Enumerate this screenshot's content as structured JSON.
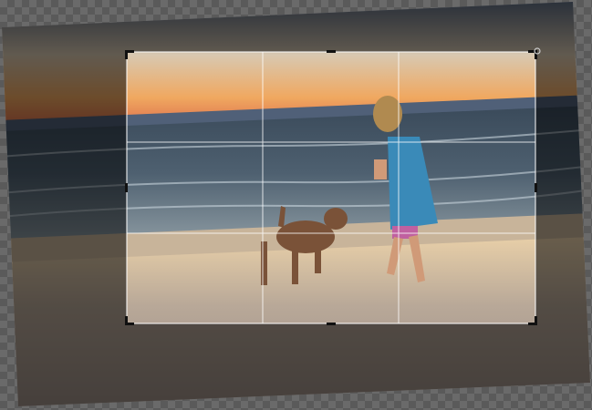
{
  "editor": {
    "mode": "crop",
    "overlay": "rule-of-thirds",
    "grid_divisions": 3,
    "rotation_degrees": -2.5,
    "colors": {
      "canvas_checker_light": "#6a6a6a",
      "canvas_checker_dark": "#5a5a5a",
      "crop_border": "#ffffff",
      "outside_dim": "#000000"
    },
    "icons": [
      "rotate-handle-icon",
      "corner-handle-icon",
      "edge-handle-icon"
    ]
  }
}
